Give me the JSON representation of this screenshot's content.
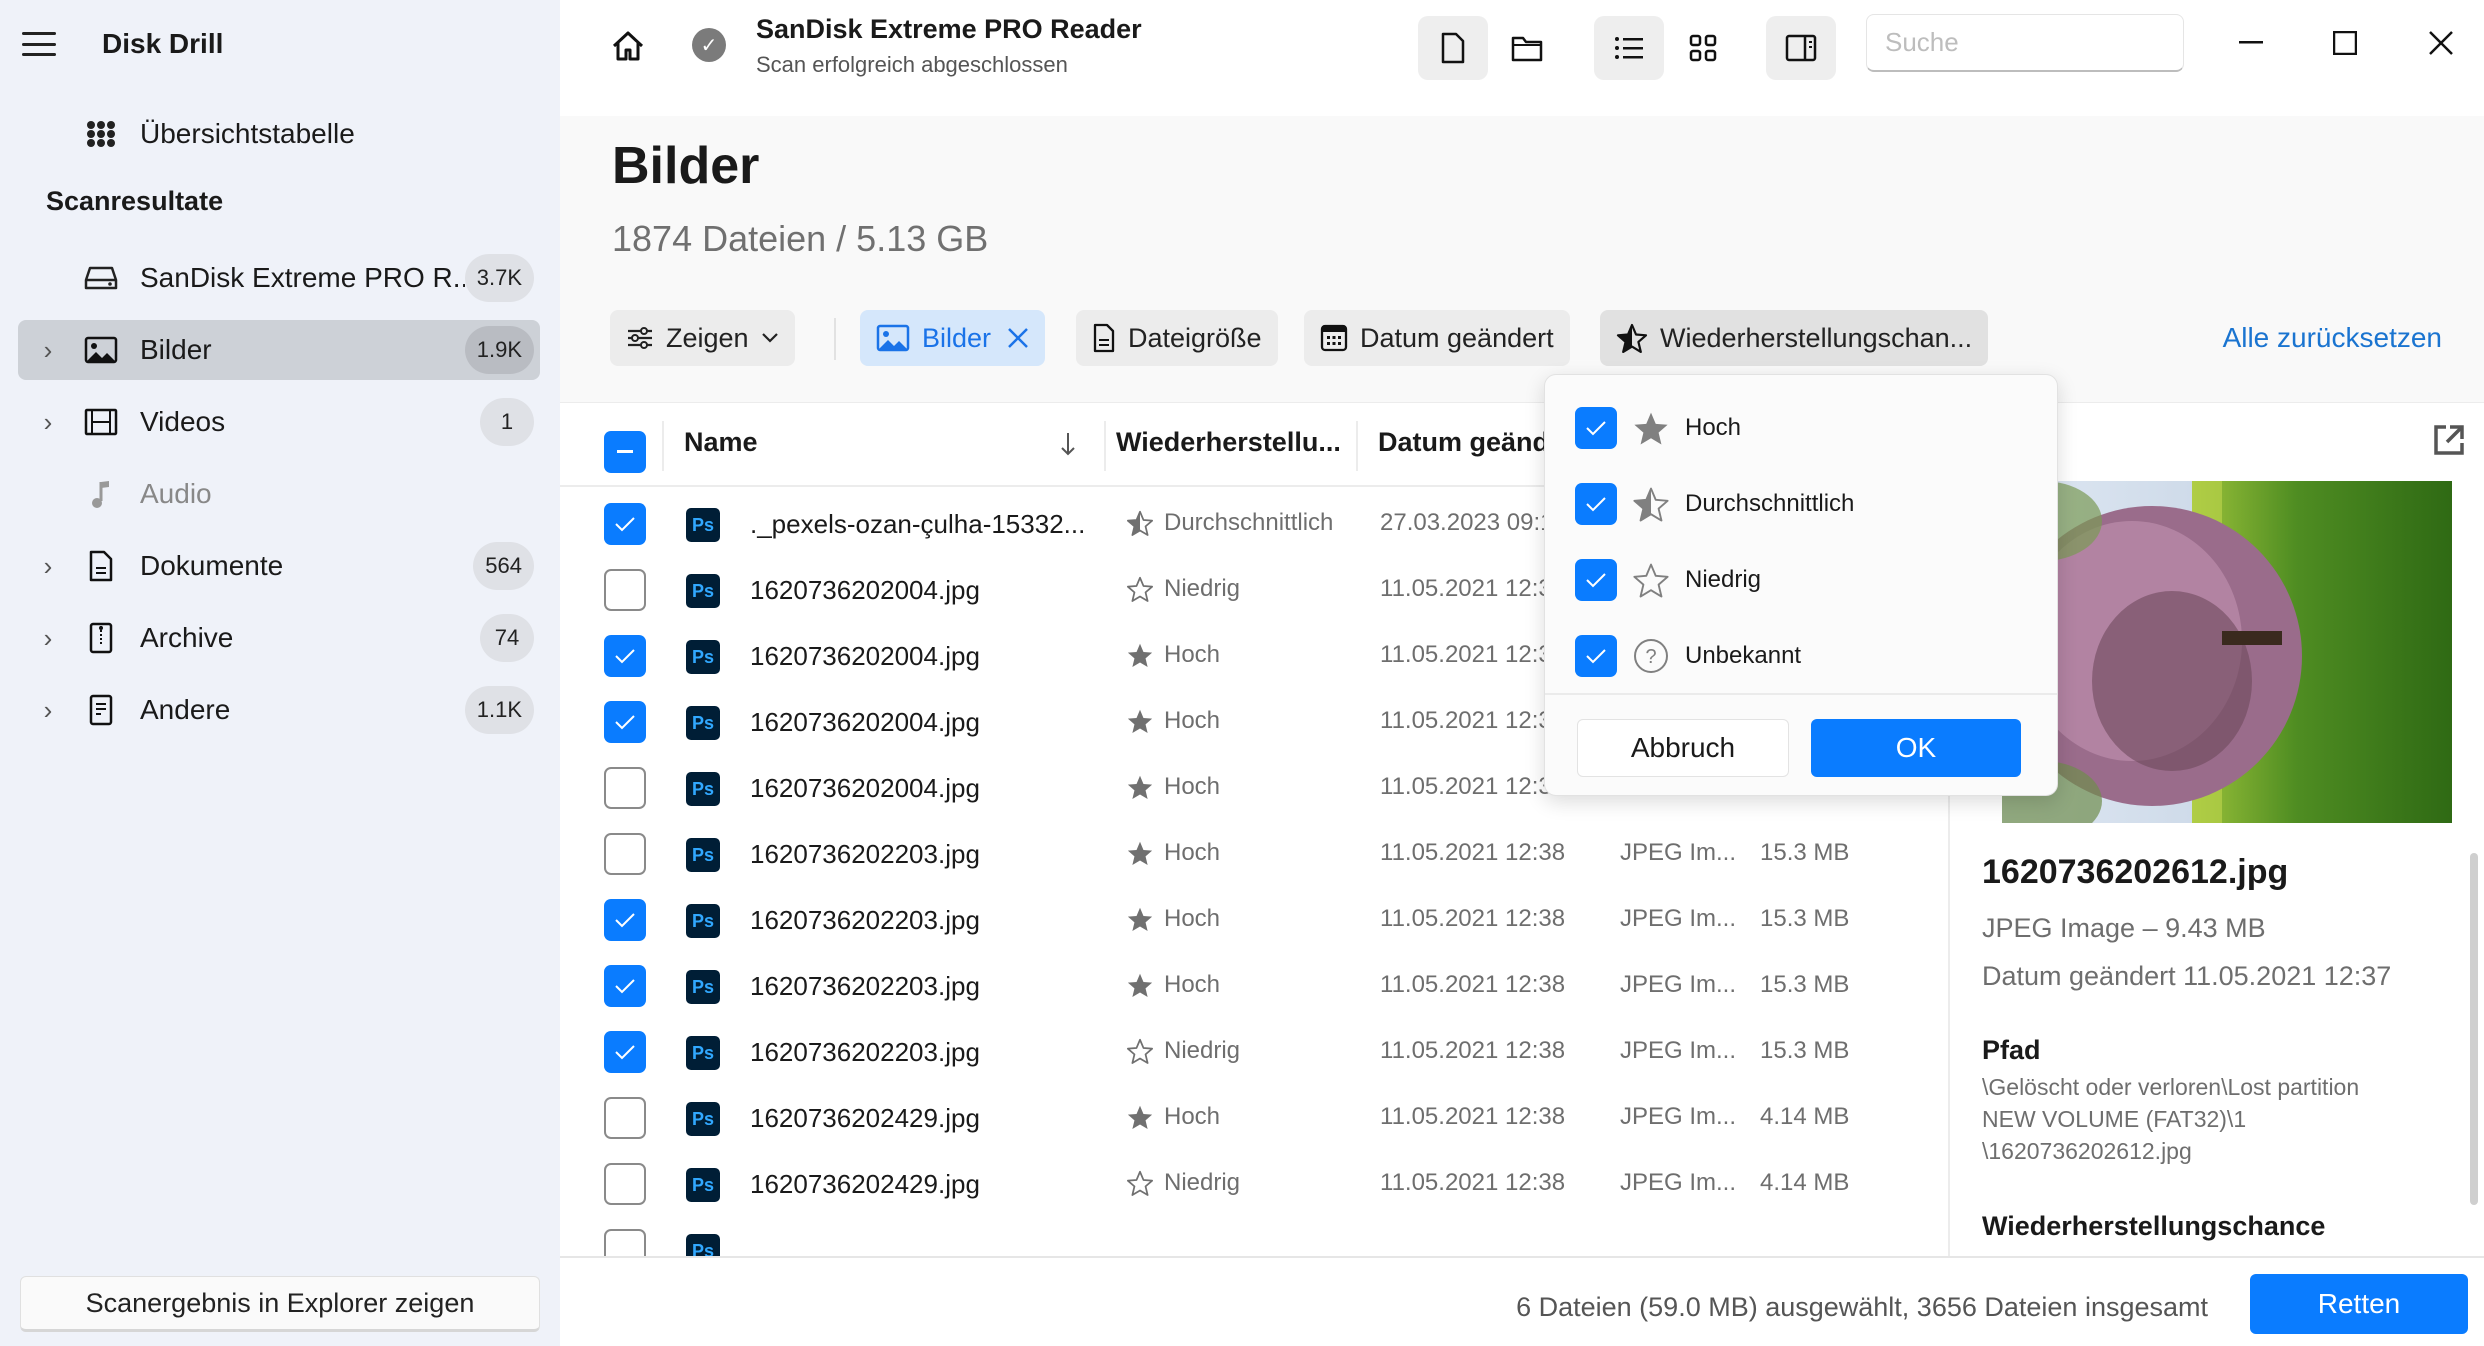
{
  "app": {
    "title": "Disk Drill"
  },
  "sidebar": {
    "overview_label": "Übersichtstabelle",
    "section_title": "Scanresultate",
    "device": {
      "label": "SanDisk Extreme PRO R...",
      "count": "3.7K"
    },
    "items": [
      {
        "label": "Bilder",
        "count": "1.9K",
        "icon": "image-icon",
        "active": true
      },
      {
        "label": "Videos",
        "count": "1",
        "icon": "film-icon"
      },
      {
        "label": "Audio",
        "count": "",
        "icon": "music-note-icon",
        "muted": true
      },
      {
        "label": "Dokumente",
        "count": "564",
        "icon": "document-icon"
      },
      {
        "label": "Archive",
        "count": "74",
        "icon": "archive-icon"
      },
      {
        "label": "Andere",
        "count": "1.1K",
        "icon": "other-file-icon"
      }
    ],
    "explorer_button": "Scanergebnis in Explorer zeigen"
  },
  "topbar": {
    "device_title": "SanDisk Extreme PRO Reader",
    "device_status": "Scan erfolgreich abgeschlossen",
    "search_placeholder": "Suche"
  },
  "page": {
    "title": "Bilder",
    "subtitle": "1874 Dateien / 5.13 GB"
  },
  "filters": {
    "show": "Zeigen",
    "images": "Bilder",
    "filesize": "Dateigröße",
    "date_modified": "Datum geändert",
    "recovery_chance": "Wiederherstellungschan...",
    "reset_all": "Alle zurücksetzen"
  },
  "table": {
    "columns": {
      "name": "Name",
      "chance": "Wiederherstellu...",
      "date": "Datum geänd"
    },
    "rows": [
      {
        "checked": true,
        "name": "._pexels-ozan-çulha-15332...",
        "chance": "Durchschnittlich",
        "level": "avg",
        "date": "27.03.2023 09:1",
        "type": "",
        "size": ""
      },
      {
        "checked": false,
        "name": "1620736202004.jpg",
        "chance": "Niedrig",
        "level": "low",
        "date": "11.05.2021 12:3",
        "type": "",
        "size": ""
      },
      {
        "checked": true,
        "name": "1620736202004.jpg",
        "chance": "Hoch",
        "level": "high",
        "date": "11.05.2021 12:3",
        "type": "",
        "size": ""
      },
      {
        "checked": true,
        "name": "1620736202004.jpg",
        "chance": "Hoch",
        "level": "high",
        "date": "11.05.2021 12:3",
        "type": "",
        "size": ""
      },
      {
        "checked": false,
        "name": "1620736202004.jpg",
        "chance": "Hoch",
        "level": "high",
        "date": "11.05.2021 12:3",
        "type": "",
        "size": ""
      },
      {
        "checked": false,
        "name": "1620736202203.jpg",
        "chance": "Hoch",
        "level": "high",
        "date": "11.05.2021 12:38",
        "type": "JPEG Im...",
        "size": "15.3 MB"
      },
      {
        "checked": true,
        "name": "1620736202203.jpg",
        "chance": "Hoch",
        "level": "high",
        "date": "11.05.2021 12:38",
        "type": "JPEG Im...",
        "size": "15.3 MB"
      },
      {
        "checked": true,
        "name": "1620736202203.jpg",
        "chance": "Hoch",
        "level": "high",
        "date": "11.05.2021 12:38",
        "type": "JPEG Im...",
        "size": "15.3 MB"
      },
      {
        "checked": true,
        "name": "1620736202203.jpg",
        "chance": "Niedrig",
        "level": "low",
        "date": "11.05.2021 12:38",
        "type": "JPEG Im...",
        "size": "15.3 MB"
      },
      {
        "checked": false,
        "name": "1620736202429.jpg",
        "chance": "Hoch",
        "level": "high",
        "date": "11.05.2021 12:38",
        "type": "JPEG Im...",
        "size": "4.14 MB"
      },
      {
        "checked": false,
        "name": "1620736202429.jpg",
        "chance": "Niedrig",
        "level": "low",
        "date": "11.05.2021 12:38",
        "type": "JPEG Im...",
        "size": "4.14 MB"
      }
    ]
  },
  "dropdown": {
    "options": [
      {
        "label": "Hoch",
        "checked": true,
        "icon": "star-filled-icon"
      },
      {
        "label": "Durchschnittlich",
        "checked": true,
        "icon": "star-half-icon"
      },
      {
        "label": "Niedrig",
        "checked": true,
        "icon": "star-outline-icon"
      },
      {
        "label": "Unbekannt",
        "checked": true,
        "icon": "question-circle-icon"
      }
    ],
    "cancel": "Abbruch",
    "ok": "OK"
  },
  "preview": {
    "filename": "1620736202612.jpg",
    "type_size": "JPEG Image – 9.43 MB",
    "date": "Datum geändert 11.05.2021 12:37",
    "path_heading": "Pfad",
    "path_lines": [
      "\\Gelöscht oder verloren\\Lost partition",
      "NEW VOLUME (FAT32)\\1",
      "\\1620736202612.jpg"
    ],
    "chance_heading": "Wiederherstellungschance"
  },
  "footer": {
    "status": "6 Dateien (59.0 MB) ausgewählt, 3656 Dateien insgesamt",
    "recover": "Retten"
  },
  "colors": {
    "accent": "#0a7cff",
    "link": "#1a74d0",
    "sidebar_bg": "#eff2f9"
  }
}
